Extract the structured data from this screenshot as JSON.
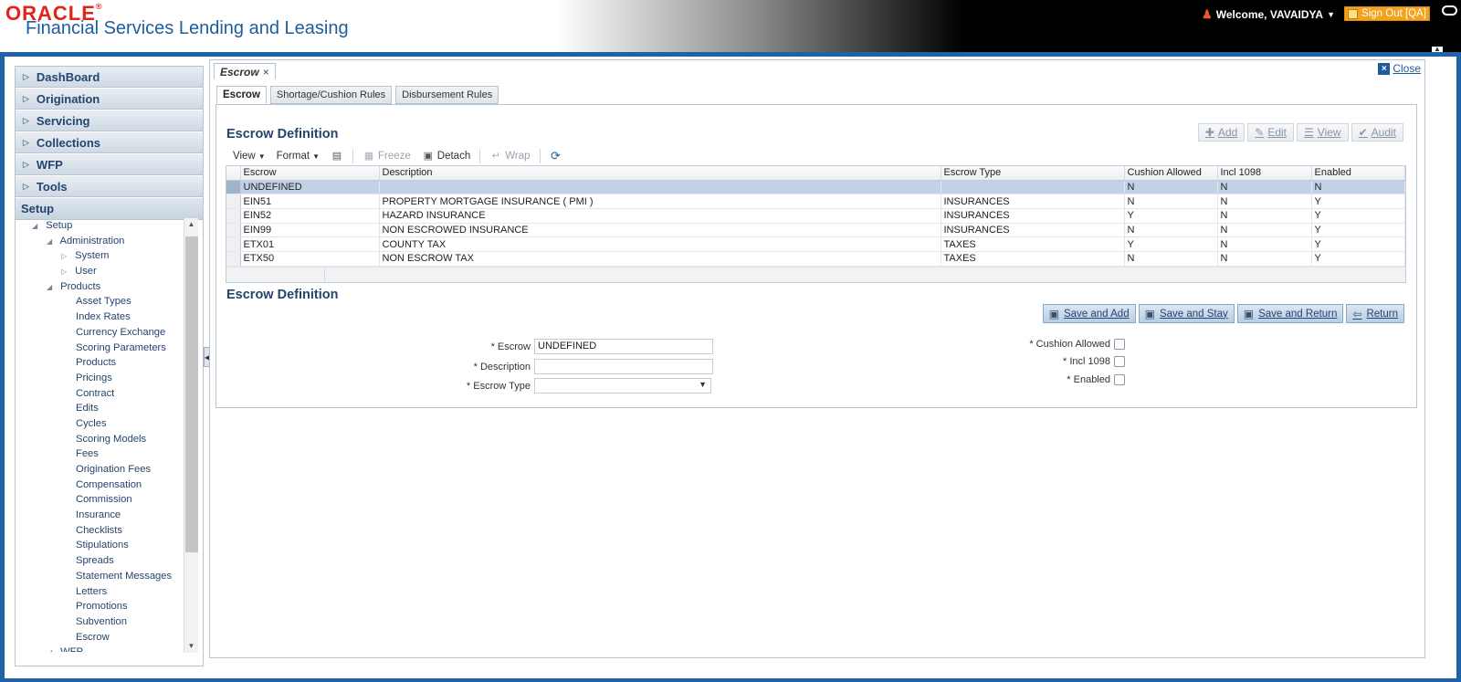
{
  "header": {
    "brand": "ORACLE",
    "brand_reg": "®",
    "product": "Financial Services Lending and Leasing",
    "welcome": "Welcome, VAVAIDYA",
    "signout": "Sign Out [QA]"
  },
  "nav": {
    "accordion": [
      "DashBoard",
      "Origination",
      "Servicing",
      "Collections",
      "WFP",
      "Tools"
    ],
    "setup_header": "Setup",
    "tree": [
      {
        "label": "Setup",
        "level": 0,
        "icon": "expanded"
      },
      {
        "label": "Administration",
        "level": 1,
        "icon": "expanded"
      },
      {
        "label": "System",
        "level": 2,
        "icon": "collapsed"
      },
      {
        "label": "User",
        "level": 2,
        "icon": "collapsed"
      },
      {
        "label": "Products",
        "level": 1,
        "icon": "expanded"
      },
      {
        "label": "Asset Types",
        "level": 3,
        "icon": "none"
      },
      {
        "label": "Index Rates",
        "level": 3,
        "icon": "none"
      },
      {
        "label": "Currency Exchange",
        "level": 3,
        "icon": "none"
      },
      {
        "label": "Scoring Parameters",
        "level": 3,
        "icon": "none"
      },
      {
        "label": "Products",
        "level": 3,
        "icon": "none"
      },
      {
        "label": "Pricings",
        "level": 3,
        "icon": "none"
      },
      {
        "label": "Contract",
        "level": 3,
        "icon": "none"
      },
      {
        "label": "Edits",
        "level": 3,
        "icon": "none"
      },
      {
        "label": "Cycles",
        "level": 3,
        "icon": "none"
      },
      {
        "label": "Scoring Models",
        "level": 3,
        "icon": "none"
      },
      {
        "label": "Fees",
        "level": 3,
        "icon": "none"
      },
      {
        "label": "Origination Fees",
        "level": 3,
        "icon": "none"
      },
      {
        "label": "Compensation",
        "level": 3,
        "icon": "none"
      },
      {
        "label": "Commission",
        "level": 3,
        "icon": "none"
      },
      {
        "label": "Insurance",
        "level": 3,
        "icon": "none"
      },
      {
        "label": "Checklists",
        "level": 3,
        "icon": "none"
      },
      {
        "label": "Stipulations",
        "level": 3,
        "icon": "none"
      },
      {
        "label": "Spreads",
        "level": 3,
        "icon": "none"
      },
      {
        "label": "Statement Messages",
        "level": 3,
        "icon": "none"
      },
      {
        "label": "Letters",
        "level": 3,
        "icon": "none"
      },
      {
        "label": "Promotions",
        "level": 3,
        "icon": "none"
      },
      {
        "label": "Subvention",
        "level": 3,
        "icon": "none"
      },
      {
        "label": "Escrow",
        "level": 3,
        "icon": "none"
      },
      {
        "label": "WFP",
        "level": 1,
        "icon": "expanded"
      }
    ]
  },
  "page": {
    "tab_title": "Escrow",
    "close_label": "Close",
    "tabs": [
      "Escrow",
      "Shortage/Cushion Rules",
      "Disbursement Rules"
    ],
    "section_title": "Escrow Definition",
    "actions": [
      "Add",
      "Edit",
      "View",
      "Audit"
    ],
    "toolbar": {
      "view": "View",
      "format": "Format",
      "freeze": "Freeze",
      "detach": "Detach",
      "wrap": "Wrap"
    },
    "columns": [
      "Escrow",
      "Description",
      "Escrow Type",
      "Cushion Allowed",
      "Incl 1098",
      "Enabled"
    ],
    "rows": [
      [
        "UNDEFINED",
        "",
        "",
        "N",
        "N",
        "N"
      ],
      [
        "EIN51",
        "PROPERTY MORTGAGE INSURANCE ( PMI )",
        "INSURANCES",
        "N",
        "N",
        "Y"
      ],
      [
        "EIN52",
        "HAZARD INSURANCE",
        "INSURANCES",
        "Y",
        "N",
        "Y"
      ],
      [
        "EIN99",
        "NON ESCROWED INSURANCE",
        "INSURANCES",
        "N",
        "N",
        "Y"
      ],
      [
        "ETX01",
        "COUNTY TAX",
        "TAXES",
        "Y",
        "N",
        "Y"
      ],
      [
        "ETX50",
        "NON ESCROW TAX",
        "TAXES",
        "N",
        "N",
        "Y"
      ]
    ],
    "form_title": "Escrow Definition",
    "form_buttons": [
      "Save and Add",
      "Save and Stay",
      "Save and Return",
      "Return"
    ],
    "fields": {
      "escrow_label": "* Escrow",
      "escrow_value": "UNDEFINED",
      "description_label": "* Description",
      "description_value": "",
      "escrow_type_label": "* Escrow Type",
      "escrow_type_value": "",
      "cushion_label": "* Cushion Allowed",
      "incl1098_label": "* Incl 1098",
      "enabled_label": "* Enabled"
    }
  }
}
